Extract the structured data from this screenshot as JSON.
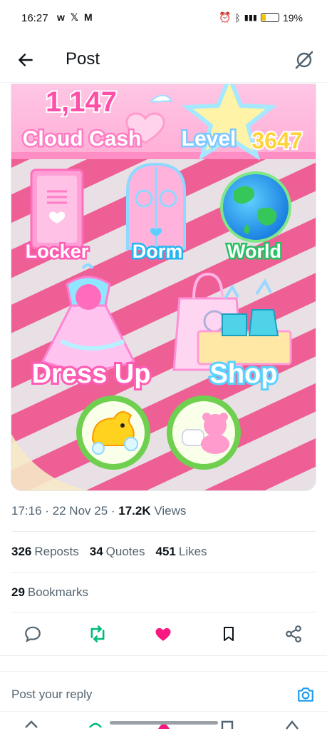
{
  "status_bar": {
    "time": "16:27",
    "apps": "w 𝕏 M",
    "signal": "⁴ᴳ",
    "battery": "19%"
  },
  "header": {
    "title": "Post"
  },
  "media": {
    "cash_value": "1,147",
    "cash_label": "Cloud Cash",
    "level_label": "Level",
    "level_value": "3647",
    "tiles": [
      "Locker",
      "Dorm",
      "World",
      "Dress Up",
      "Shop"
    ]
  },
  "meta": {
    "time": "17:16",
    "date": "22 Nov 25",
    "views_value": "17.2K",
    "views_label": "Views"
  },
  "stats": {
    "reposts_value": "326",
    "reposts_label": "Reposts",
    "quotes_value": "34",
    "quotes_label": "Quotes",
    "likes_value": "451",
    "likes_label": "Likes",
    "bookmarks_value": "29",
    "bookmarks_label": "Bookmarks"
  },
  "reply": {
    "placeholder": "Post your reply"
  },
  "colors": {
    "accent_blue": "#1d9bf0",
    "like_pink": "#f91880",
    "repost_green": "#00ba7c",
    "game_pink": "#ff6fb5"
  }
}
